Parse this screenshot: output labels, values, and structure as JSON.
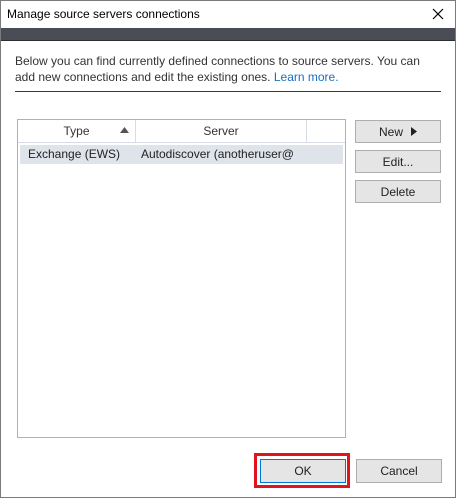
{
  "window": {
    "title": "Manage source servers connections"
  },
  "description": {
    "text": "Below you can find currently defined connections to source servers. You can add new connections and edit the existing ones. ",
    "link_label": "Learn more."
  },
  "connections_list": {
    "columns": [
      "Type",
      "Server"
    ],
    "sort_column": "Type",
    "sort_direction": "ascending",
    "rows": [
      {
        "type": "Exchange (EWS)",
        "server": "Autodiscover (anotheruser@"
      }
    ]
  },
  "side_buttons": {
    "new_label": "New",
    "edit_label": "Edit...",
    "delete_label": "Delete"
  },
  "footer": {
    "ok_label": "OK",
    "cancel_label": "Cancel"
  },
  "colors": {
    "header_band": "#4a4d55",
    "separator": "#1f3f66",
    "link": "#1a6fc0",
    "selected_row": "#dfe3ea",
    "highlight_box": "#e0141e",
    "default_button_border": "#0078d7"
  },
  "icons": {
    "close": "close-icon",
    "sort": "sort-ascending-icon",
    "new_menu": "triangle-right-icon"
  }
}
